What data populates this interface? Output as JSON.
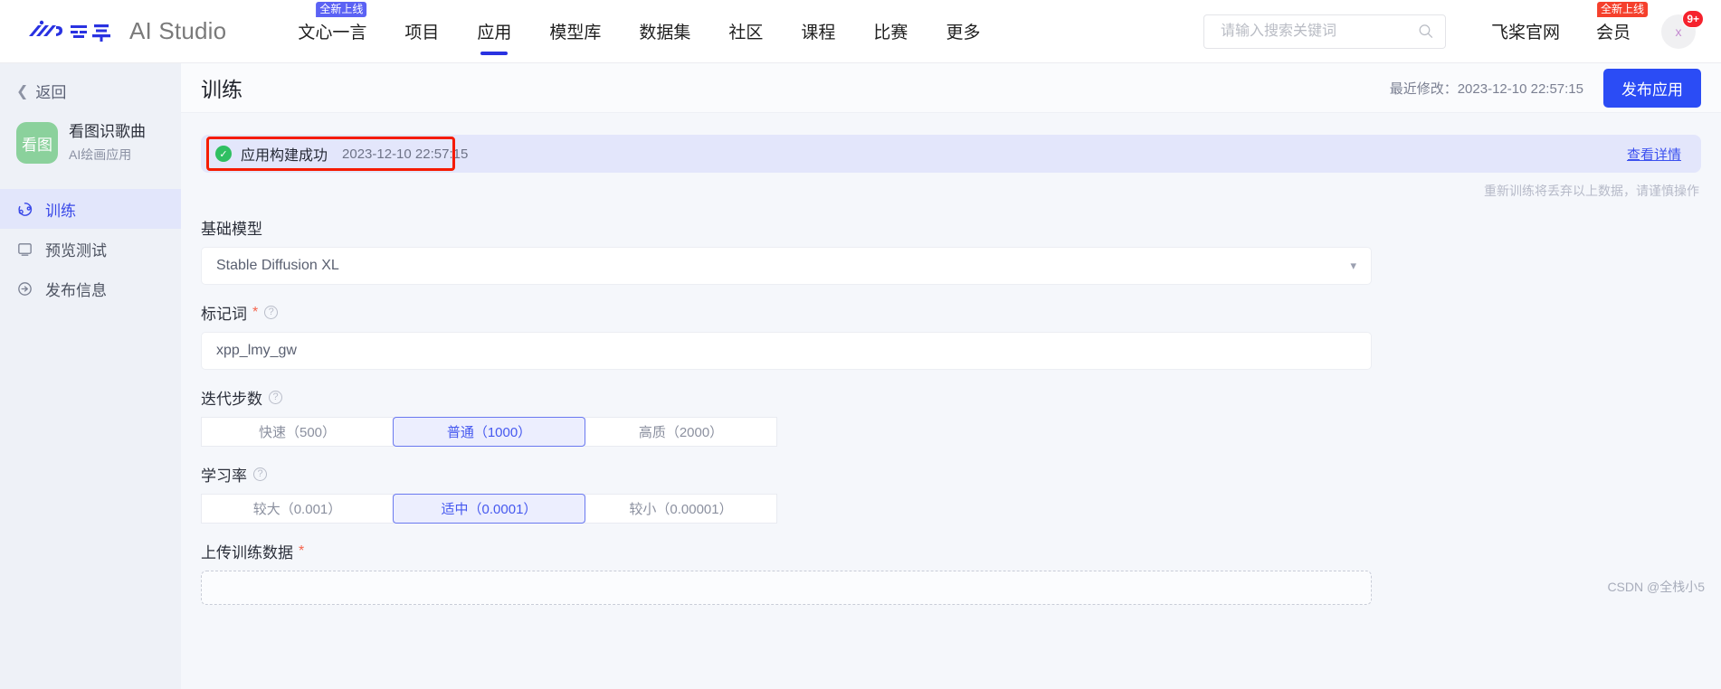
{
  "header": {
    "brand_name": "AI Studio",
    "nav_items": [
      {
        "label": "文心一言",
        "badge": "全新上线",
        "active": false
      },
      {
        "label": "项目",
        "badge": "",
        "active": false
      },
      {
        "label": "应用",
        "badge": "",
        "active": true
      },
      {
        "label": "模型库",
        "badge": "",
        "active": false
      },
      {
        "label": "数据集",
        "badge": "",
        "active": false
      },
      {
        "label": "社区",
        "badge": "",
        "active": false
      },
      {
        "label": "课程",
        "badge": "",
        "active": false
      },
      {
        "label": "比赛",
        "badge": "",
        "active": false
      },
      {
        "label": "更多",
        "badge": "",
        "active": false
      }
    ],
    "search": {
      "placeholder": "请输入搜索关键词",
      "value": ""
    },
    "right_links": [
      {
        "label": "飞桨官网",
        "badge": ""
      },
      {
        "label": "会员",
        "badge": "全新上线"
      }
    ],
    "avatar": {
      "initial": "x",
      "notification_count": "9+"
    }
  },
  "sidebar": {
    "back_label": "返回",
    "app": {
      "icon_text": "看图",
      "name": "看图识歌曲",
      "subtitle": "AI绘画应用"
    },
    "items": [
      {
        "label": "训练",
        "active": true
      },
      {
        "label": "预览测试",
        "active": false
      },
      {
        "label": "发布信息",
        "active": false
      }
    ]
  },
  "page": {
    "title": "训练",
    "modified_label": "最近修改：",
    "modified_time": "2023-12-10 22:57:15",
    "publish_button": "发布应用"
  },
  "banner": {
    "status_text": "应用构建成功",
    "timestamp": "2023-12-10 22:57:15",
    "detail_link": "查看详情",
    "warning_note": "重新训练将丢弃以上数据，请谨慎操作"
  },
  "form": {
    "base_model": {
      "label": "基础模型",
      "value": "Stable Diffusion XL"
    },
    "trigger_word": {
      "label": "标记词",
      "required_mark": "*",
      "help": "?",
      "value": "xpp_lmy_gw"
    },
    "steps": {
      "label": "迭代步数",
      "help": "?",
      "options": [
        {
          "label": "快速（500）",
          "selected": false
        },
        {
          "label": "普通（1000）",
          "selected": true
        },
        {
          "label": "高质（2000）",
          "selected": false
        }
      ]
    },
    "learning_rate": {
      "label": "学习率",
      "help": "?",
      "options": [
        {
          "label": "较大（0.001）",
          "selected": false
        },
        {
          "label": "适中（0.0001）",
          "selected": true
        },
        {
          "label": "较小（0.00001）",
          "selected": false
        }
      ]
    },
    "upload": {
      "label": "上传训练数据",
      "required_mark": "*"
    }
  },
  "watermark": "CSDN @全栈小5",
  "colors": {
    "accent": "#2b4cf5",
    "accent_light": "#5b62f4",
    "success": "#2fbf62",
    "danger": "#f5222d",
    "annotation": "#f51b00"
  }
}
